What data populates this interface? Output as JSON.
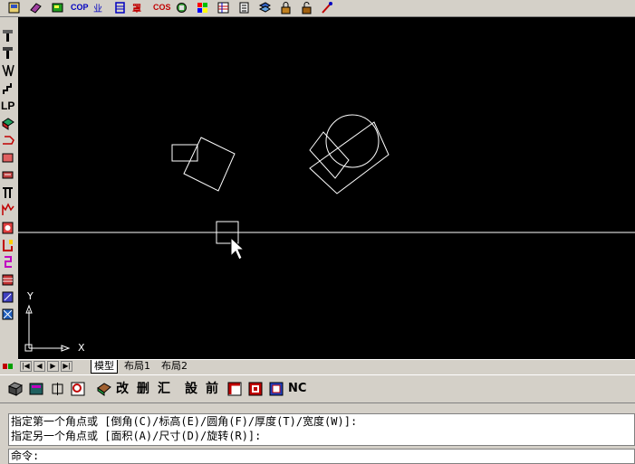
{
  "top_toolbar": {
    "icons": [
      "open-file",
      "layer-tool",
      "properties",
      "cop-text",
      "offset-text",
      "block",
      "layout",
      "cos-text",
      "hatch",
      "color-palette",
      "list",
      "stack",
      "print",
      "lock-left",
      "lock-right",
      "magic"
    ],
    "labels": {
      "cop": "COP",
      "cos": "COS"
    }
  },
  "left_toolbar": {
    "icons": [
      "pin",
      "pin-2",
      "pin-3",
      "stair",
      "lp",
      "cube",
      "line-arrow",
      "frame",
      "measure",
      "cable",
      "roof",
      "plant",
      "pipe",
      "section",
      "region",
      "fill",
      "diag"
    ],
    "labels": {
      "lp": "LP"
    }
  },
  "canvas": {
    "axis_labels": {
      "y": "Y",
      "x": "X"
    }
  },
  "tabs": {
    "items": [
      "模型",
      "布局1",
      "布局2"
    ],
    "active": "模型"
  },
  "bottom_toolbar": {
    "labels": [
      "改",
      "删",
      "汇",
      "設",
      "前"
    ],
    "nc_label": "NC"
  },
  "command": {
    "history": [
      "指定第一个角点或 [倒角(C)/标高(E)/圆角(F)/厚度(T)/宽度(W)]:",
      "指定另一个角点或 [面积(A)/尺寸(D)/旋转(R)]:"
    ],
    "prompt": "命令:"
  },
  "colors": {
    "canvas_bg": "#000000",
    "geometry": "#ffffff",
    "chrome": "#d4d0c8"
  }
}
